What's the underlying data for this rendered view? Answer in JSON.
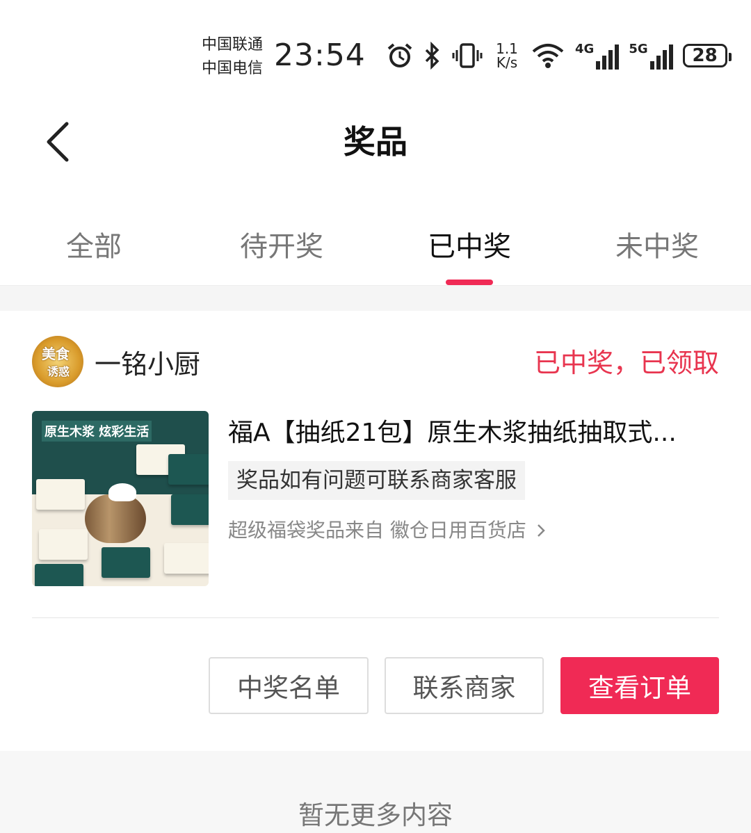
{
  "status_bar": {
    "carrier_1": "中国联通",
    "carrier_2": "中国电信",
    "time": "23:54",
    "net_speed_value": "1.1",
    "net_speed_unit": "K/s",
    "signal_1": "4G",
    "signal_2": "5G",
    "battery": "28",
    "icons": [
      "alarm-icon",
      "bluetooth-icon",
      "vibrate-icon",
      "wifi-icon",
      "signal-4g-icon",
      "signal-5g-icon",
      "battery-icon"
    ]
  },
  "header": {
    "title": "奖品",
    "back_icon": "chevron-left-icon"
  },
  "tabs": [
    {
      "label": "全部",
      "active": false
    },
    {
      "label": "待开奖",
      "active": false
    },
    {
      "label": "已中奖",
      "active": true
    },
    {
      "label": "未中奖",
      "active": false
    }
  ],
  "prize_card": {
    "shop_name": "一铭小厨",
    "avatar_text": [
      "美食",
      "诱惑"
    ],
    "status": "已中奖，已领取",
    "product_image_text": "原生木浆 炫彩生活",
    "product_title": "福A【抽纸21包】原生木浆抽纸抽取式...",
    "tag": "奖品如有问题可联系商家客服",
    "from_label": "超级福袋奖品来自 徽仓日用百货店",
    "buttons": {
      "winners": "中奖名单",
      "contact": "联系商家",
      "view_order": "查看订单"
    }
  },
  "footer": {
    "no_more": "暂无更多内容"
  },
  "colors": {
    "accent": "#f02a55",
    "status_red": "#e8354f"
  }
}
